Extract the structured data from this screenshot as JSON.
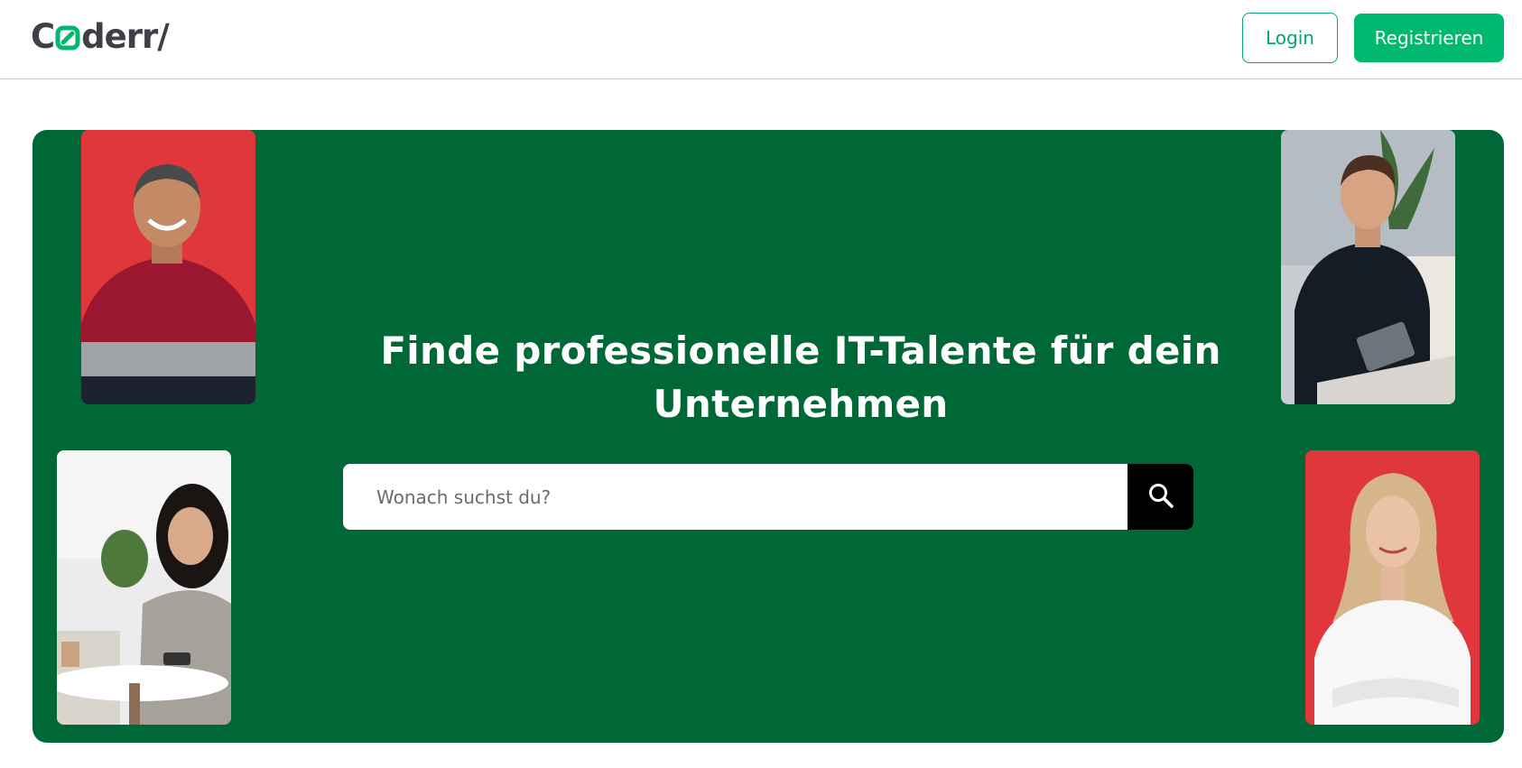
{
  "header": {
    "logo": {
      "text_before": "C",
      "text_after": "derr/",
      "brand_color": "#00b86e",
      "text_color": "#3d4047"
    },
    "login_label": "Login",
    "register_label": "Registrieren"
  },
  "hero": {
    "background": "#006837",
    "title": "Finde professionelle IT-Talente für dein Unternehmen",
    "search": {
      "placeholder": "Wonach suchst du?",
      "value": "",
      "button_icon": "search-icon"
    },
    "photos": [
      {
        "name": "photo-man-red-sweater",
        "background": "#e0373c"
      },
      {
        "name": "photo-woman-phone-cafe",
        "background": "#eeeeee"
      },
      {
        "name": "photo-man-tablet",
        "background": "#cfd3d8"
      },
      {
        "name": "photo-woman-white-blouse",
        "background": "#e0373c"
      }
    ]
  },
  "colors": {
    "accent": "#00b86e",
    "hero_green": "#006837",
    "search_button": "#000000"
  }
}
